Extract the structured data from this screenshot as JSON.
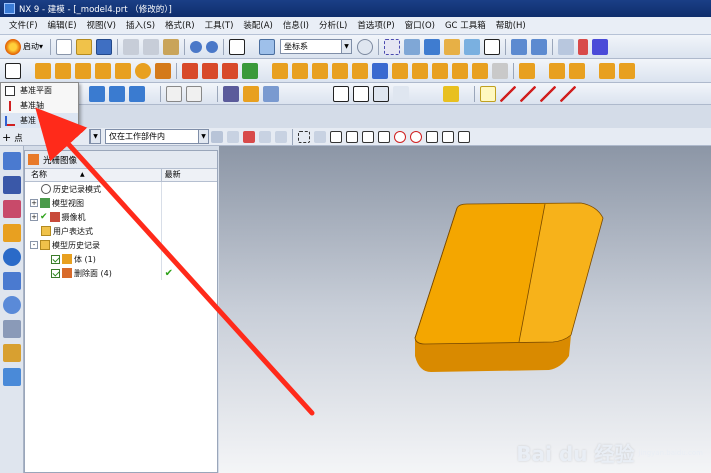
{
  "window": {
    "title": "NX 9 - 建模 - [_model4.prt （修改的）]"
  },
  "menu": [
    "文件(F)",
    "编辑(E)",
    "视图(V)",
    "插入(S)",
    "格式(R)",
    "工具(T)",
    "装配(A)",
    "信息(I)",
    "分析(L)",
    "首选项(P)",
    "窗口(O)",
    "GC 工具箱",
    "帮助(H)"
  ],
  "toolbar1": {
    "start_label": "启动▾",
    "coord_combo": "坐标系"
  },
  "toolbar4": {
    "filter_combo": "仅在工作部件内"
  },
  "dropdown": {
    "items": [
      {
        "label": "基准平面",
        "icon": "datum-plane-icon"
      },
      {
        "label": "基准轴",
        "icon": "datum-axis-icon"
      },
      {
        "label": "基准 CSYS",
        "icon": "datum-csys-icon"
      }
    ]
  },
  "point": {
    "label": "点"
  },
  "nav": {
    "title": "光栅图像",
    "col_name": "名称",
    "col_latest": "最新",
    "rows": [
      {
        "label": "历史记录模式",
        "icon": "history-clock-icon",
        "expand": "",
        "check": false,
        "latest": ""
      },
      {
        "label": "模型视图",
        "icon": "model-view-icon",
        "expand": "+",
        "check": false,
        "latest": ""
      },
      {
        "label": "摄像机",
        "icon": "camera-icon",
        "expand": "+",
        "check": true,
        "latest": ""
      },
      {
        "label": "用户表达式",
        "icon": "user-expression-icon",
        "expand": "",
        "check": false,
        "latest": ""
      },
      {
        "label": "模型历史记录",
        "icon": "folder-icon",
        "expand": "-",
        "check": false,
        "latest": ""
      },
      {
        "label": "体 (1)",
        "icon": "body-icon",
        "expand": "",
        "check": true,
        "latest": ""
      },
      {
        "label": "删除面 (4)",
        "icon": "delete-face-icon",
        "expand": "",
        "check": true,
        "latest": "✔"
      }
    ]
  },
  "watermark": {
    "brand": "Bai du 经验",
    "sub": "jingyan.baidu.com"
  },
  "colors": {
    "accent": "#ff2a1a",
    "part_fill": "#f3a400",
    "title_bar": "#1a3f86"
  }
}
